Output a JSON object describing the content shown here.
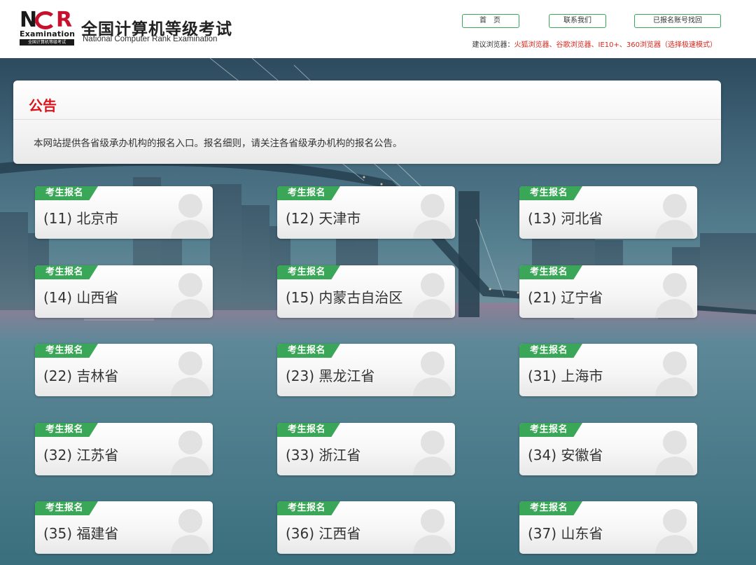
{
  "header": {
    "logo": {
      "letters_n": "N",
      "letters_r": "R",
      "examination": "Examination",
      "bar_text": "全国计算机等级考试"
    },
    "title": "全国计算机等级考试",
    "subtitle": "National Computer Rank Examination",
    "nav": {
      "home": "首页",
      "contact": "联系我们",
      "recover": "已报名账号找回"
    },
    "browser_tip_label": "建议浏览器：",
    "browser_tip_value": "火狐浏览器、谷歌浏览器、IE10+、360浏览器（选择极速模式）"
  },
  "notice": {
    "title": "公告",
    "text": "本网站提供各省级承办机构的报名入口。报名细则，请关注各省级承办机构的报名公告。"
  },
  "cards": {
    "badge": "考生报名",
    "items": [
      {
        "name": "(11) 北京市"
      },
      {
        "name": "(12) 天津市"
      },
      {
        "name": "(13) 河北省"
      },
      {
        "name": "(14) 山西省"
      },
      {
        "name": "(15) 内蒙古自治区"
      },
      {
        "name": "(21) 辽宁省"
      },
      {
        "name": "(22) 吉林省"
      },
      {
        "name": "(23) 黑龙江省"
      },
      {
        "name": "(31) 上海市"
      },
      {
        "name": "(32) 江苏省"
      },
      {
        "name": "(33) 浙江省"
      },
      {
        "name": "(34) 安徽省"
      },
      {
        "name": "(35) 福建省"
      },
      {
        "name": "(36) 江西省"
      },
      {
        "name": "(37) 山东省"
      }
    ]
  },
  "colors": {
    "brand_green": "#3aa657",
    "notice_red": "#d9141c",
    "tip_red": "#d9261c",
    "logo_red": "#c8102e"
  }
}
